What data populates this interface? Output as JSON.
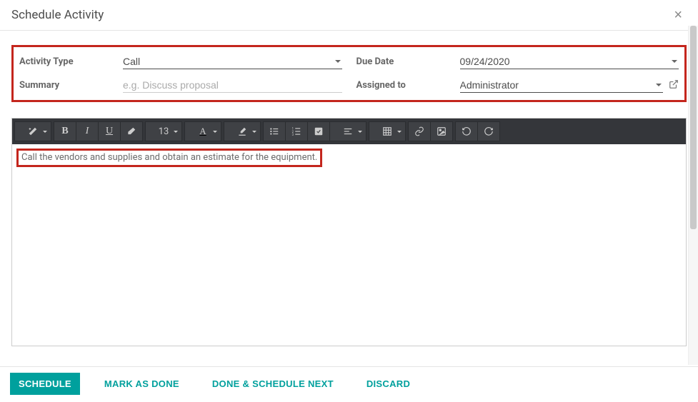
{
  "header": {
    "title": "Schedule Activity"
  },
  "form": {
    "activity_type": {
      "label": "Activity Type",
      "value": "Call"
    },
    "summary": {
      "label": "Summary",
      "placeholder": "e.g. Discuss proposal",
      "value": ""
    },
    "due_date": {
      "label": "Due Date",
      "value": "09/24/2020"
    },
    "assigned_to": {
      "label": "Assigned to",
      "value": "Administrator"
    }
  },
  "toolbar": {
    "font_size": "13"
  },
  "editor": {
    "content": "Call the vendors and supplies and obtain an estimate for the equipment."
  },
  "footer": {
    "schedule": "SCHEDULE",
    "mark_done": "MARK AS DONE",
    "done_next": "DONE & SCHEDULE NEXT",
    "discard": "DISCARD"
  }
}
